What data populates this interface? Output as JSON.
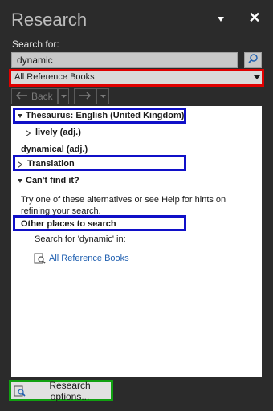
{
  "pane": {
    "title": "Research"
  },
  "search": {
    "label": "Search for:",
    "value": "dynamic"
  },
  "source": {
    "selected": "All Reference Books"
  },
  "nav": {
    "back_label": "Back"
  },
  "results": {
    "thesaurus_header": "Thesaurus: English (United Kingdom)",
    "synonym_1": "lively (adj.)",
    "synonym_2": "dynamical (adj.)",
    "translation": "Translation",
    "cant_find": "Can't find it?",
    "hint": "Try one of these alternatives or see Help for hints on refining your search.",
    "other_places": "Other places to search",
    "search_for_in": "Search for 'dynamic' in:",
    "all_reference_link": "All Reference Books"
  },
  "footer": {
    "options_label": "Research options..."
  },
  "colors": {
    "highlight_red": "#e00000",
    "highlight_blue": "#1010c8",
    "highlight_green": "#11a011",
    "link": "#1f5fb0"
  },
  "icons": [
    "pin-icon",
    "close-icon",
    "search-icon",
    "dropdown-arrow-icon",
    "back-arrow-icon",
    "forward-arrow-icon",
    "expand-triangle-icon",
    "collapse-triangle-icon",
    "book-search-icon"
  ]
}
